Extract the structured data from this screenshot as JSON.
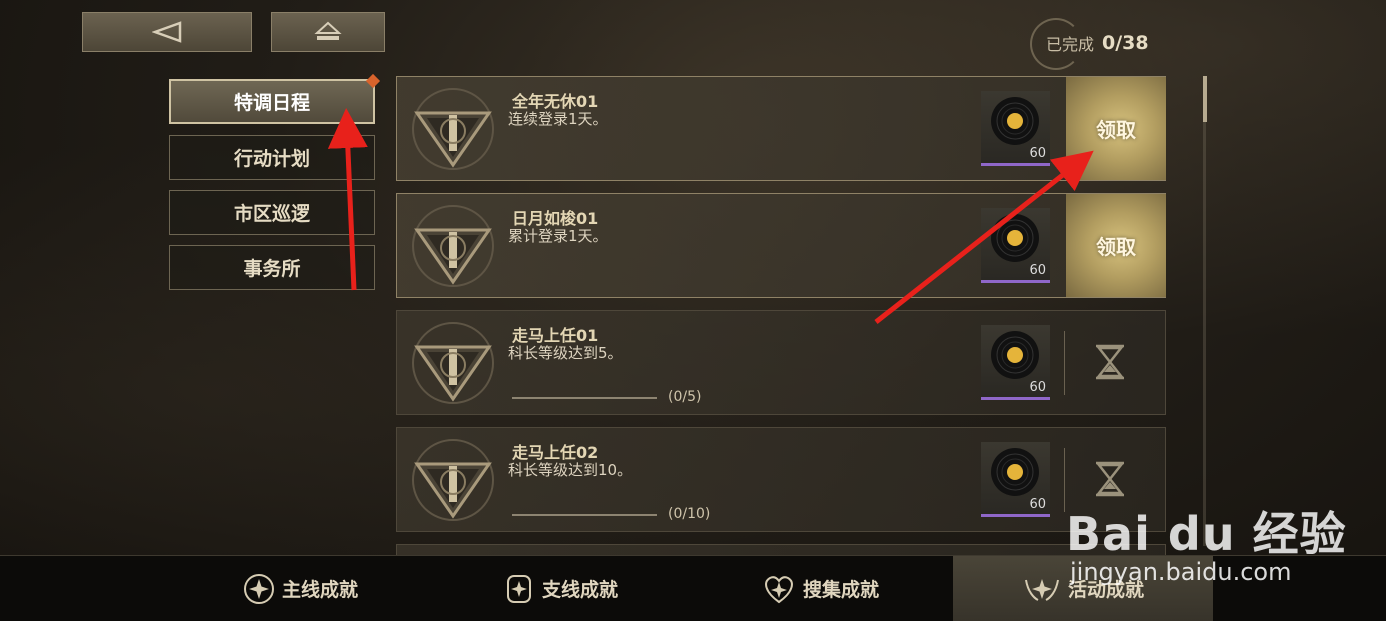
{
  "header": {
    "back_icon": "back-triangle-icon",
    "home_icon": "eject-home-icon",
    "progress_label": "已完成",
    "progress_value": "0/38"
  },
  "categories": [
    {
      "label": "特调日程",
      "active": true
    },
    {
      "label": "行动计划",
      "active": false
    },
    {
      "label": "市区巡逻",
      "active": false
    },
    {
      "label": "事务所",
      "active": false
    }
  ],
  "tasks": [
    {
      "title": "全年无休01",
      "desc": "连续登录1天。",
      "reward_count": "60",
      "status": "claim",
      "button_label": "领取"
    },
    {
      "title": "日月如梭01",
      "desc": "累计登录1天。",
      "reward_count": "60",
      "status": "claim",
      "button_label": "领取"
    },
    {
      "title": "走马上任01",
      "desc": "科长等级达到5。",
      "reward_count": "60",
      "status": "pending",
      "progress_text": "(0/5)"
    },
    {
      "title": "走马上任02",
      "desc": "科长等级达到10。",
      "reward_count": "60",
      "status": "pending",
      "progress_text": "(0/10)"
    }
  ],
  "bottom_tabs": [
    {
      "label": "主线成就",
      "icon": "star-shield-icon"
    },
    {
      "label": "支线成就",
      "icon": "star-badge-icon"
    },
    {
      "label": "搜集成就",
      "icon": "star-heart-icon"
    },
    {
      "label": "活动成就",
      "icon": "star-wings-icon",
      "active": true
    }
  ],
  "watermark": {
    "logo_text": "Bai du 经验",
    "site": "jingyan.baidu.com"
  },
  "colors": {
    "claim_gold": "#c8b16c",
    "reward_purple": "#8f67c9",
    "notify_dot": "#d9632c",
    "annotation_red": "#e8211b"
  }
}
